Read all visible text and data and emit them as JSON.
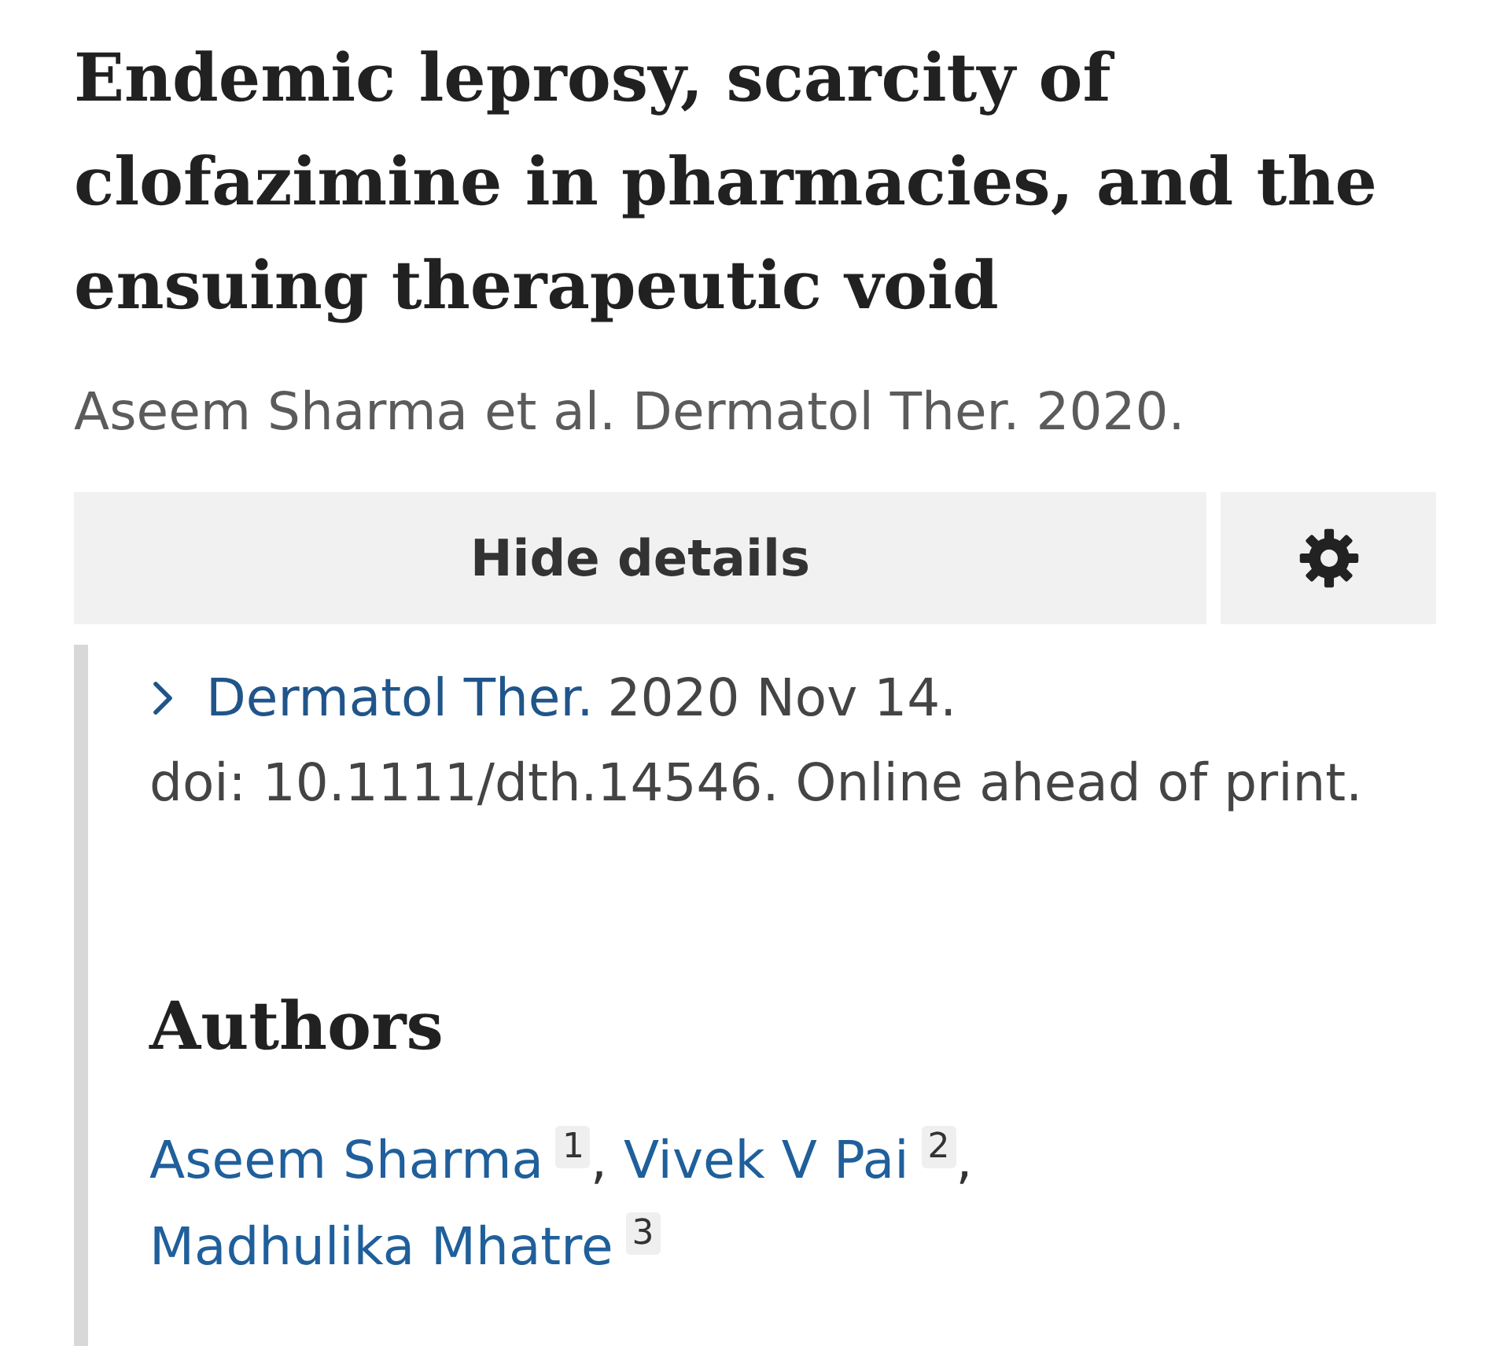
{
  "title": "Endemic leprosy, scarcity of clofazimine in pharmacies, and the ensuing therapeutic void",
  "byline": "Aseem Sharma et al. Dermatol Ther. 2020.",
  "actions": [
    {
      "kind": "toggle",
      "label": "Hide details"
    },
    {
      "kind": "settings"
    }
  ],
  "details": {
    "journal": "Dermatol Ther.",
    "date": "2020 Nov 14.",
    "doi": "doi: 10.1111/dth.14546. Online ahead of print."
  },
  "authors": {
    "heading": "Authors",
    "list": [
      {
        "name": "Aseem Sharma",
        "affiliation": "1",
        "separator": ","
      },
      {
        "name": "Vivek V Pai",
        "affiliation": "2",
        "separator": ","
      },
      {
        "name": "Madhulika Mhatre",
        "affiliation": "3"
      }
    ]
  }
}
